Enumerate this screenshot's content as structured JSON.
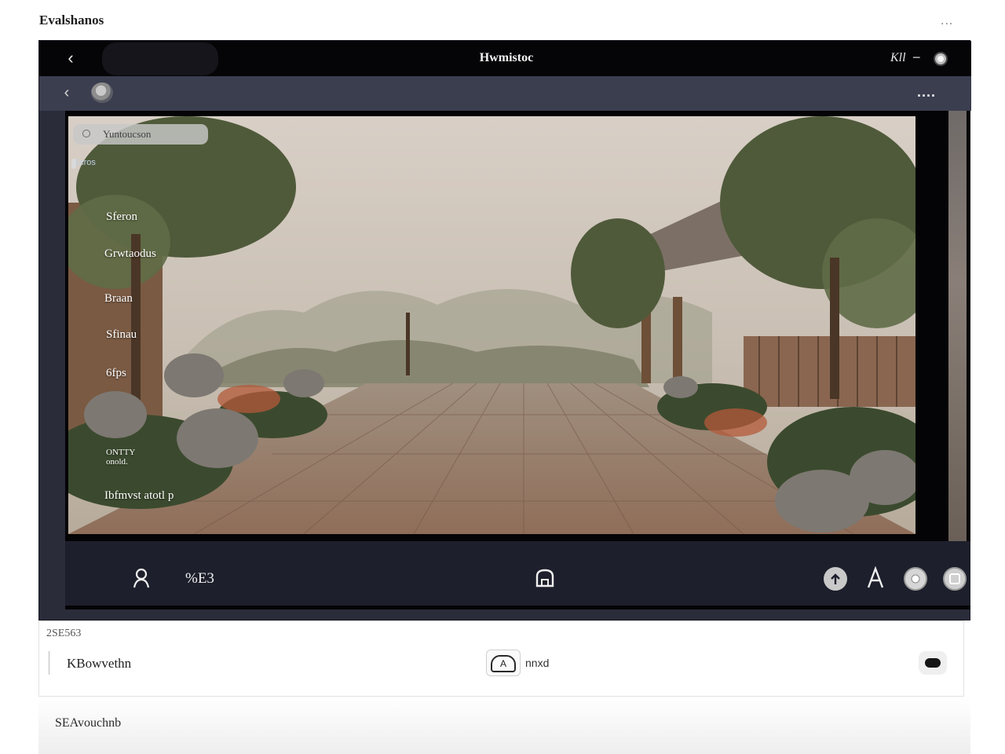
{
  "page": {
    "title": "Evalshanos",
    "menu_label": "..."
  },
  "window": {
    "title": "Hwmistoc",
    "right_label": "Kll",
    "minimize_glyph": "−",
    "subbar_more": "...."
  },
  "viewer": {
    "search_placeholder": "Yuntoucson",
    "tag": "1cros",
    "menu": [
      "Sferon",
      "Grwtaodus",
      "Braan",
      "Sfinau",
      "6fps"
    ],
    "small_item": "ONTTY\nonold.",
    "info_item": "Ibfmvst atotl p"
  },
  "controls": {
    "left_icon": "user-icon",
    "left_text": "%E3",
    "center_icon": "home-icon",
    "right_icons": [
      "cloud-upload-icon",
      "text-icon",
      "disc-icon",
      "square-icon"
    ]
  },
  "bottom_panel": {
    "code": "2SE563",
    "name": "KBowvethn",
    "chip_glyph": "A",
    "chip_label": "nnxd"
  },
  "footer": {
    "text": "SEAvouchnb"
  },
  "colors": {
    "window_bg": "#2a2c3a",
    "titlebar": "#050507",
    "subbar": "#3b3e4f",
    "controls": "#1d1f2c"
  }
}
